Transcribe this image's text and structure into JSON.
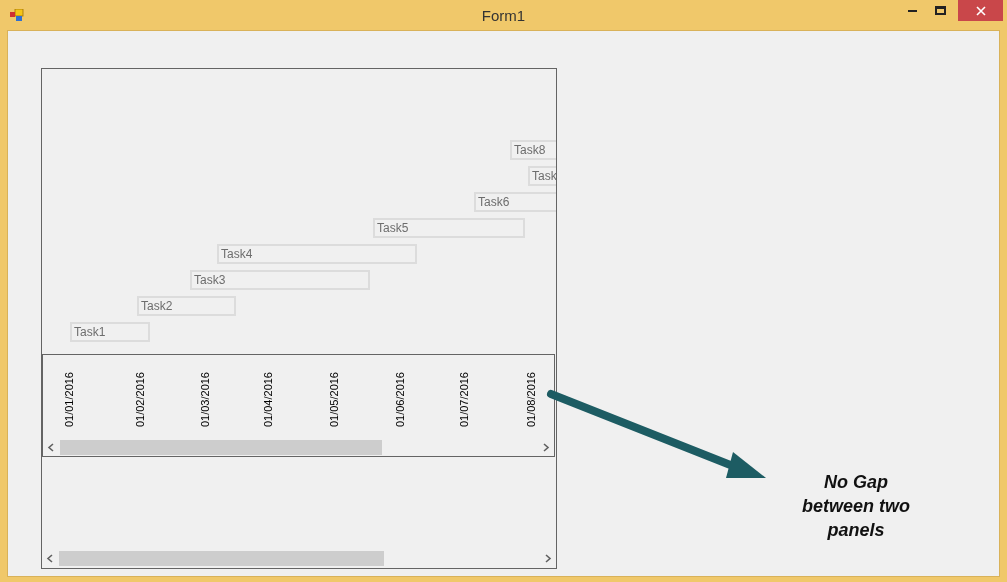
{
  "window": {
    "title": "Form1"
  },
  "tasks": [
    {
      "label": "Task1"
    },
    {
      "label": "Task2"
    },
    {
      "label": "Task3"
    },
    {
      "label": "Task4"
    },
    {
      "label": "Task5"
    },
    {
      "label": "Task6"
    },
    {
      "label": "Task"
    },
    {
      "label": "Task8"
    }
  ],
  "dates": [
    "01/01/2016",
    "01/02/2016",
    "01/03/2016",
    "01/04/2016",
    "01/05/2016",
    "01/06/2016",
    "01/07/2016",
    "01/08/2016"
  ],
  "annotation": "No Gap between two panels"
}
